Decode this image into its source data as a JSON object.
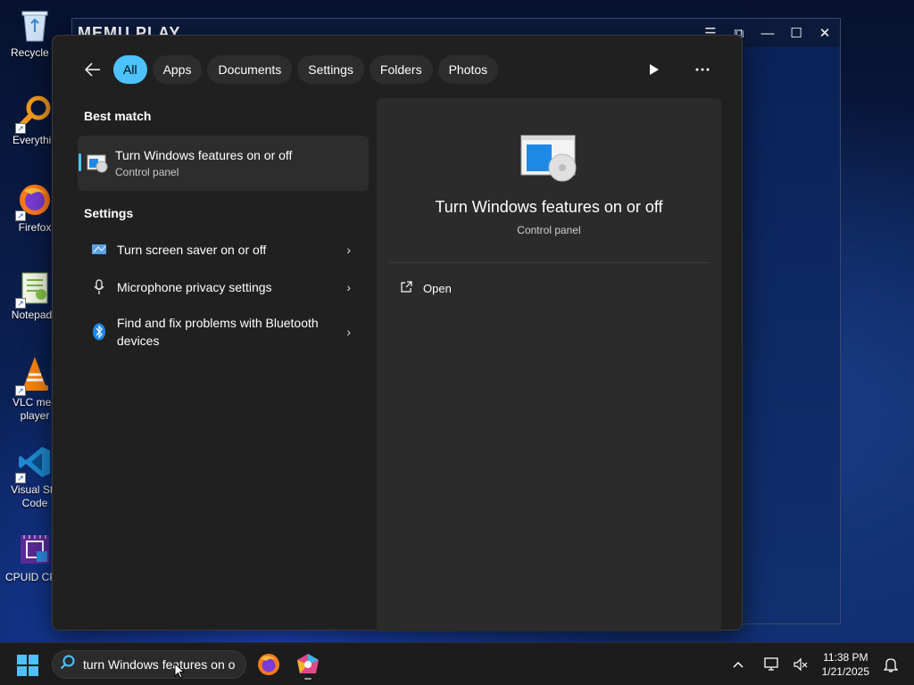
{
  "desktop": {
    "icons": [
      {
        "label": "Recycle B",
        "icon": "recycle-bin-icon"
      },
      {
        "label": "Everythin",
        "icon": "everything-search-icon"
      },
      {
        "label": "Firefox",
        "icon": "firefox-icon"
      },
      {
        "label": "Notepad+",
        "icon": "notepad-plus-plus-icon"
      },
      {
        "label": "VLC med",
        "label2": "player",
        "icon": "vlc-icon"
      },
      {
        "label": "Visual Stu",
        "label2": "Code",
        "icon": "vscode-icon"
      },
      {
        "label": "CPUID CPU",
        "icon": "cpuid-icon"
      }
    ]
  },
  "background_window": {
    "title": "MEMU PLAY"
  },
  "search_panel": {
    "filters": [
      "All",
      "Apps",
      "Documents",
      "Settings",
      "Folders",
      "Photos"
    ],
    "active_filter": "All",
    "best_match_heading": "Best match",
    "best_match": {
      "title": "Turn Windows features on or off",
      "subtitle": "Control panel"
    },
    "settings_heading": "Settings",
    "settings_items": [
      {
        "title": "Turn screen saver on or off",
        "icon": "screen-saver-icon"
      },
      {
        "title": "Microphone privacy settings",
        "icon": "microphone-icon"
      },
      {
        "title": "Find and fix problems with Bluetooth devices",
        "icon": "bluetooth-icon"
      }
    ],
    "preview": {
      "title": "Turn Windows features on or off",
      "subtitle": "Control panel",
      "actions": [
        {
          "label": "Open",
          "icon": "open-external-icon"
        }
      ]
    }
  },
  "taskbar": {
    "search_value": "turn Windows features on or off",
    "clock_time": "11:38 PM",
    "clock_date": "1/21/2025"
  },
  "colors": {
    "accent": "#4cc2ff",
    "panel_bg": "#202020",
    "preview_bg": "#2b2b2b"
  }
}
